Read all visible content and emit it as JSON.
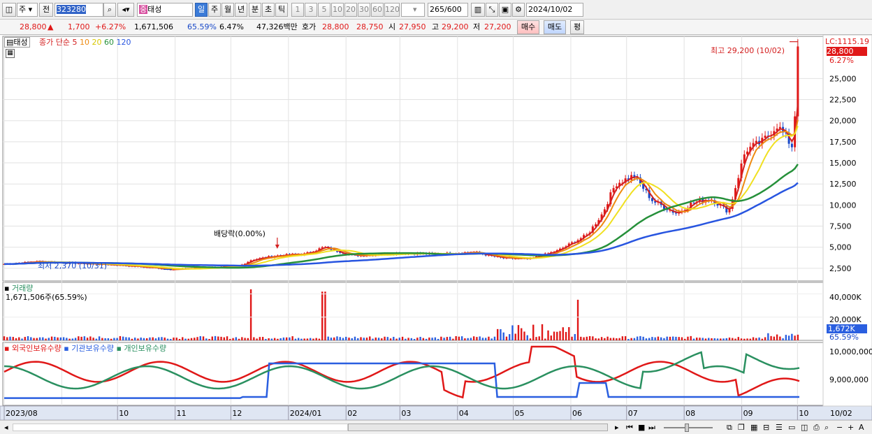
{
  "toolbar": {
    "market": "주",
    "prev": "전",
    "code": "323280",
    "stock_tag": "중",
    "stock_name": "태성",
    "periods": [
      "일",
      "주",
      "월",
      "년",
      "분",
      "초",
      "틱"
    ],
    "intervals": [
      "1",
      "3",
      "5",
      "10",
      "20",
      "30",
      "60",
      "120"
    ],
    "count": "265",
    "count_max": "/600",
    "date": "2024/10/02"
  },
  "quote": {
    "price": "28,800",
    "arrow": "▲",
    "change": "1,700",
    "change_pct": "+6.27%",
    "volume": "1,671,506",
    "volume_ratio": "65.59%",
    "turnover": "6.47%",
    "amount": "47,326백만",
    "bid_label": "호가",
    "bid1": "28,800",
    "bid2": "28,750",
    "open_label": "시",
    "open": "27,950",
    "high_label": "고",
    "high": "29,200",
    "low_label": "저",
    "low": "27,200",
    "buy_btn": "매수",
    "sell_btn": "매도",
    "eval_btn": "평"
  },
  "price_panel": {
    "name_tag": "태성",
    "ma_title": "종가 단순",
    "ma_periods": [
      "5",
      "10",
      "20",
      "60",
      "120"
    ],
    "ma_colors": [
      "#d42020",
      "#ee8a10",
      "#f0e020",
      "#26903a",
      "#2855e0"
    ],
    "lc_label": "LC:1115.19",
    "last_price_tag": "28,800",
    "last_pct_tag": "6.27%",
    "high_note": "최고 29,200 (10/02)",
    "low_note": "최저 2,370 (10/31)",
    "dividend_note": "배당락(0.00%)"
  },
  "volume_panel": {
    "title": "거래량",
    "value": "1,671,506주(65.59%)",
    "last_tag": "1,672K",
    "last_pct": "65.59%",
    "ticks": [
      "40,000K",
      "20,000K"
    ]
  },
  "holding_panel": {
    "series": [
      {
        "name": "외국인보유수량",
        "color": "#e01818"
      },
      {
        "name": "기관보유수량",
        "color": "#2a5fe0"
      },
      {
        "name": "개인보유수량",
        "color": "#2a9060"
      }
    ],
    "ticks": [
      "10,000,000",
      "9,000,000"
    ]
  },
  "x_axis": [
    "2023/08",
    "10",
    "11",
    "12",
    "2024/01",
    "02",
    "03",
    "04",
    "05",
    "06",
    "07",
    "08",
    "09",
    "10",
    "10/02"
  ],
  "chart_data": {
    "type": "line",
    "x": [
      "2023-08",
      "2023-09",
      "2023-10",
      "2023-11",
      "2023-12",
      "2024-01",
      "2024-02",
      "2024-03",
      "2024-04",
      "2024-05",
      "2024-06",
      "2024-07",
      "2024-08",
      "2024-09",
      "2024-10"
    ],
    "close_series": {
      "name": "종가",
      "points": [
        [
          "2023-08-01",
          3000
        ],
        [
          "2023-08-20",
          3300
        ],
        [
          "2023-09-10",
          3100
        ],
        [
          "2023-10-01",
          2900
        ],
        [
          "2023-10-31",
          2370
        ],
        [
          "2023-11-20",
          2600
        ],
        [
          "2023-12-05",
          2700
        ],
        [
          "2023-12-12",
          3500
        ],
        [
          "2023-12-26",
          4000
        ],
        [
          "2024-01-10",
          4200
        ],
        [
          "2024-01-20",
          5000
        ],
        [
          "2024-02-05",
          4000
        ],
        [
          "2024-03-01",
          4300
        ],
        [
          "2024-03-20",
          4200
        ],
        [
          "2024-04-10",
          4400
        ],
        [
          "2024-04-25",
          3700
        ],
        [
          "2024-05-10",
          3600
        ],
        [
          "2024-05-25",
          4600
        ],
        [
          "2024-06-10",
          6500
        ],
        [
          "2024-06-18",
          9000
        ],
        [
          "2024-06-25",
          12500
        ],
        [
          "2024-07-05",
          13500
        ],
        [
          "2024-07-15",
          10500
        ],
        [
          "2024-07-28",
          9000
        ],
        [
          "2024-08-05",
          10200
        ],
        [
          "2024-08-15",
          10800
        ],
        [
          "2024-08-25",
          9200
        ],
        [
          "2024-09-03",
          16500
        ],
        [
          "2024-09-12",
          17500
        ],
        [
          "2024-09-20",
          19500
        ],
        [
          "2024-09-28",
          17000
        ],
        [
          "2024-10-01",
          24000
        ],
        [
          "2024-10-02",
          28800
        ]
      ]
    },
    "y_axis_ticks": [
      2500,
      5000,
      7500,
      10000,
      12500,
      15000,
      17500,
      20000,
      22500,
      25000
    ],
    "ylim": [
      1000,
      30000
    ],
    "moving_averages": [
      "5",
      "10",
      "20",
      "60",
      "120"
    ],
    "high": 29200,
    "low": 2370,
    "volume_peaks_k": [
      {
        "date": "2023-12-12",
        "value": 44000
      },
      {
        "date": "2024-01-20",
        "value": 42000
      },
      {
        "date": "2024-06-05",
        "value": 35000
      }
    ],
    "holding_ylim": [
      8750000,
      10000000
    ]
  }
}
